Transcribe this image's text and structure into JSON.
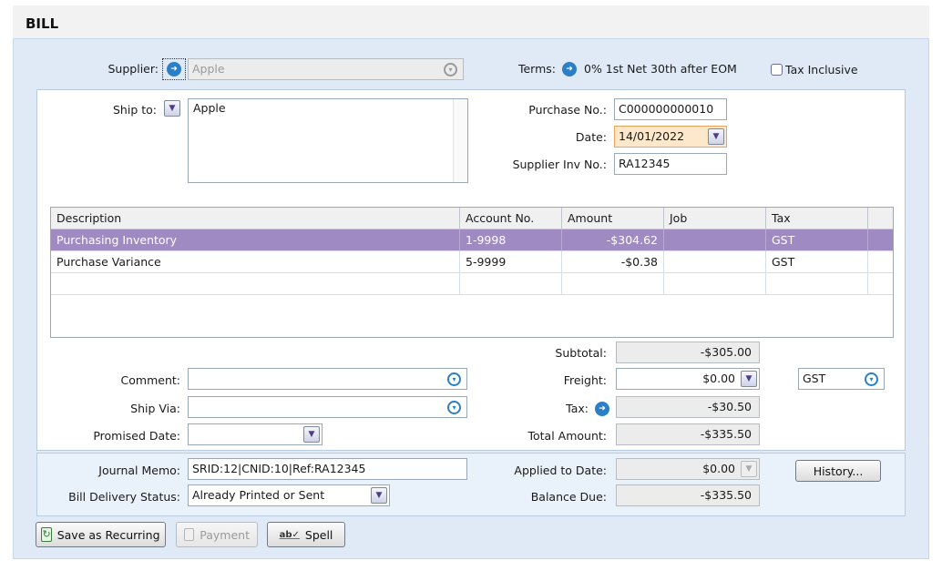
{
  "window": {
    "title": "BILL"
  },
  "supplier": {
    "label": "Supplier:",
    "value": "Apple"
  },
  "terms": {
    "label": "Terms:",
    "value": "0% 1st Net 30th after EOM"
  },
  "tax_inclusive": {
    "label": "Tax Inclusive",
    "checked": false
  },
  "ship_to": {
    "label": "Ship to:",
    "value": "Apple"
  },
  "purchase_no": {
    "label": "Purchase No.:",
    "value": "C000000000010"
  },
  "date": {
    "label": "Date:",
    "value": "14/01/2022"
  },
  "supplier_inv": {
    "label": "Supplier Inv No.:",
    "value": "RA12345"
  },
  "table": {
    "columns": [
      "Description",
      "Account No.",
      "Amount",
      "Job",
      "Tax"
    ],
    "rows": [
      {
        "description": "Purchasing Inventory",
        "account": "1-9998",
        "amount": "-$304.62",
        "job": "",
        "tax": "GST"
      },
      {
        "description": "Purchase Variance",
        "account": "5-9999",
        "amount": "-$0.38",
        "job": "",
        "tax": "GST"
      }
    ]
  },
  "comment": {
    "label": "Comment:",
    "value": ""
  },
  "ship_via": {
    "label": "Ship Via:",
    "value": ""
  },
  "promised_date": {
    "label": "Promised Date:",
    "value": ""
  },
  "totals": {
    "subtotal_label": "Subtotal:",
    "subtotal": "-$305.00",
    "freight_label": "Freight:",
    "freight": "$0.00",
    "freight_tax": "GST",
    "tax_label": "Tax:",
    "tax": "-$30.50",
    "total_label": "Total Amount:",
    "total": "-$335.50"
  },
  "journal_memo": {
    "label": "Journal Memo:",
    "value": "SRID:12|CNID:10|Ref:RA12345"
  },
  "delivery_status": {
    "label": "Bill Delivery Status:",
    "value": "Already Printed or Sent"
  },
  "applied": {
    "label": "Applied to Date:",
    "value": "$0.00"
  },
  "balance": {
    "label": "Balance Due:",
    "value": "-$335.50"
  },
  "buttons": {
    "history": "History...",
    "save_recurring": "Save as Recurring",
    "payment": "Payment",
    "spell": "Spell"
  },
  "icons": {
    "arrow": "arrow-right-circle-icon",
    "dropdown": "chevron-down-icon",
    "recurring": "recurring-icon",
    "payment": "payment-icon",
    "spell": "spell-check-icon"
  },
  "colors": {
    "selected_row": "#9f8bc2",
    "accent_blue": "#2a7fc7",
    "date_field": "#fde8cc",
    "frame_bg": "#dfeaf6"
  }
}
